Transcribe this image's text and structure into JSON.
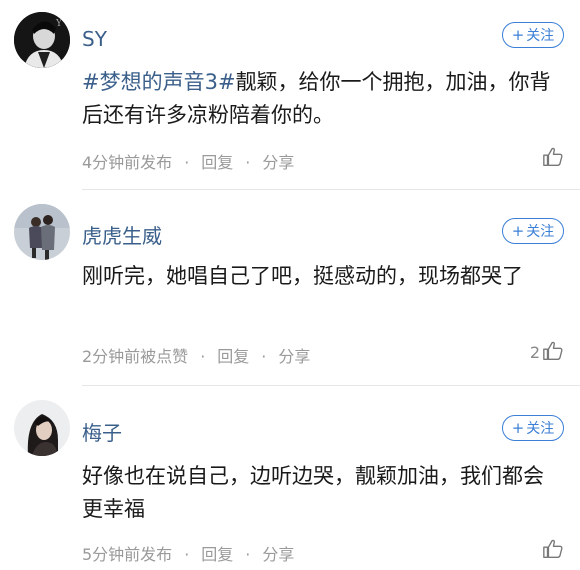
{
  "follow_label": "关注",
  "comments": [
    {
      "username": "SY",
      "hashtag": "#梦想的声音3#",
      "text": "靓颖，给你一个拥抱，加油，你背后还有许多凉粉陪着你的。",
      "time": "4分钟前发布",
      "reply": "回复",
      "share": "分享",
      "likes": ""
    },
    {
      "username": "虎虎生威",
      "text": "刚听完，她唱自己了吧，挺感动的，现场都哭了",
      "time": "2分钟前被点赞",
      "reply": "回复",
      "share": "分享",
      "likes": "2"
    },
    {
      "username": "梅子",
      "text": "好像也在说自己，边听边哭，靓颖加油，我们都会更幸福",
      "time": "5分钟前发布",
      "reply": "回复",
      "share": "分享",
      "likes": ""
    }
  ]
}
